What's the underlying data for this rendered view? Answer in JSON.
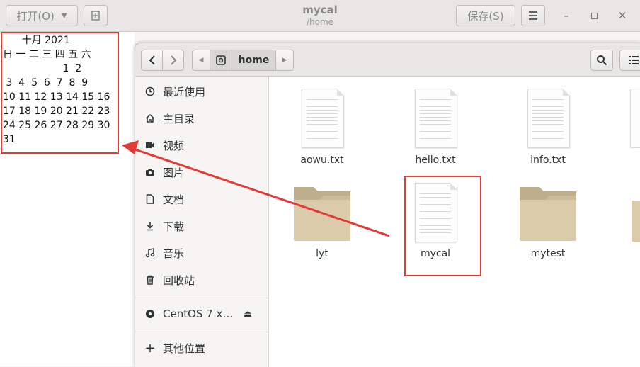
{
  "window": {
    "open_label": "打开(O)",
    "title": "mycal",
    "subtitle": "/home",
    "save_label": "保存(S)"
  },
  "calendar": {
    "month_year": "      十月 2021",
    "weekdays": "日 一 二 三 四 五 六",
    "rows": [
      "                   1  2",
      " 3  4  5  6  7  8  9",
      "10 11 12 13 14 15 16",
      "17 18 19 20 21 22 23",
      "24 25 26 27 28 29 30",
      "31"
    ]
  },
  "file_manager": {
    "path": "home",
    "sidebar": {
      "items": [
        {
          "label": "最近使用",
          "icon": "clock-icon"
        },
        {
          "label": "主目录",
          "icon": "home-icon"
        },
        {
          "label": "视频",
          "icon": "video-icon"
        },
        {
          "label": "图片",
          "icon": "camera-icon"
        },
        {
          "label": "文档",
          "icon": "document-icon"
        },
        {
          "label": "下载",
          "icon": "download-icon"
        },
        {
          "label": "音乐",
          "icon": "music-icon"
        },
        {
          "label": "回收站",
          "icon": "trash-icon"
        }
      ],
      "device": {
        "label": "CentOS 7 x…",
        "icon": "disc-icon"
      },
      "other": {
        "label": "其他位置",
        "icon": "plus-icon"
      }
    },
    "files": [
      {
        "name": "aowu.txt",
        "type": "text"
      },
      {
        "name": "hello.txt",
        "type": "text"
      },
      {
        "name": "info.txt",
        "type": "text"
      },
      {
        "name": "lyt",
        "type": "folder"
      },
      {
        "name": "mycal",
        "type": "text"
      },
      {
        "name": "mytest",
        "type": "folder"
      }
    ]
  },
  "colors": {
    "highlight": "#e53935",
    "folder": "#d9c7a4"
  }
}
